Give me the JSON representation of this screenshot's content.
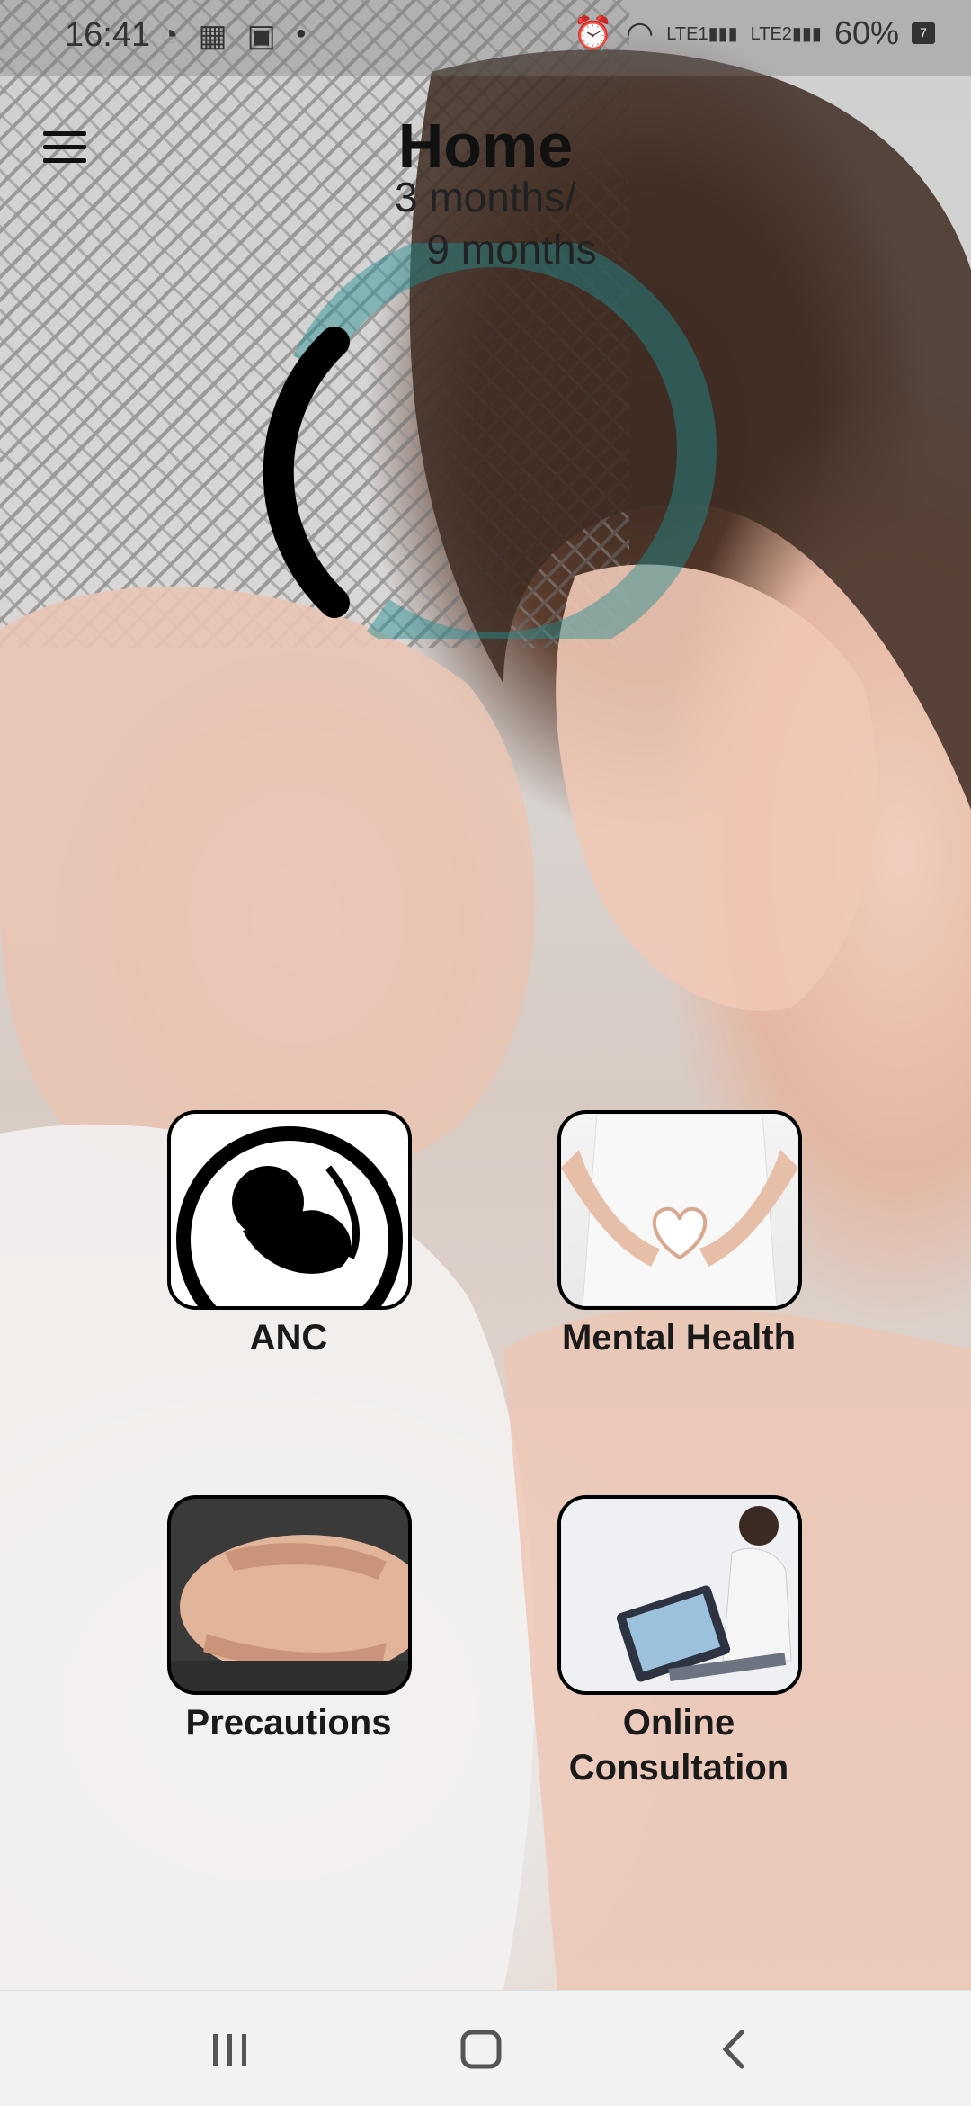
{
  "status_bar": {
    "time": "16:41",
    "battery": "60%",
    "battery_level": "7"
  },
  "app_bar": {
    "title": "Home"
  },
  "progress": {
    "line1": "3 months/",
    "line2": "9 months",
    "current_months": 3,
    "total_months": 9
  },
  "tiles": [
    {
      "label": "ANC"
    },
    {
      "label": "Mental Health"
    },
    {
      "label": "Precautions"
    },
    {
      "label": "Online Consultation"
    }
  ],
  "colors": {
    "accent": "#1f8f93",
    "ring_track": "#000000",
    "navbar_bg": "#f2f2f2"
  },
  "icons": {
    "menu": "hamburger-menu-icon",
    "recent_apps": "recent-apps-icon",
    "home": "home-icon",
    "back": "back-icon"
  }
}
